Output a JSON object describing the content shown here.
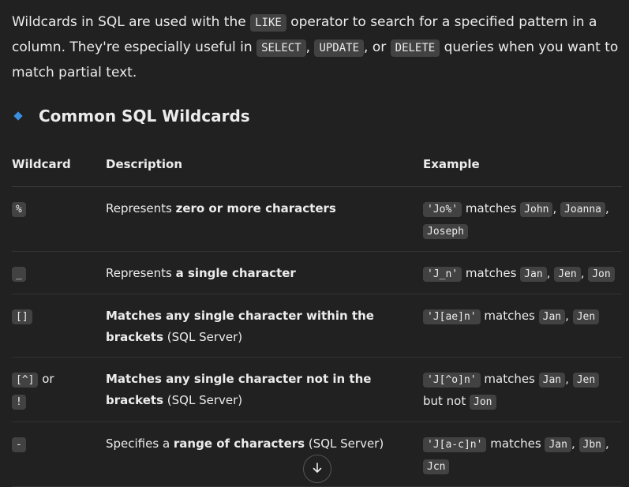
{
  "intro": {
    "t1": "Wildcards in SQL are used with the ",
    "c1": "LIKE",
    "t2": " operator to search for a specified pattern in a column. They're especially useful in ",
    "c2": "SELECT",
    "t3": ", ",
    "c3": "UPDATE",
    "t4": ", or ",
    "c4": "DELETE",
    "t5": " queries when you want to match partial text."
  },
  "heading": "Common SQL Wildcards",
  "table": {
    "headers": [
      "Wildcard",
      "Description",
      "Example"
    ],
    "rows": [
      {
        "wildcard": "%",
        "desc_pre": "Represents ",
        "desc_bold": "zero or more characters",
        "desc_post": "",
        "pattern": "'Jo%'",
        "matches_word": " matches ",
        "m1": "John",
        "m2": "Joanna",
        "m3": "Joseph"
      },
      {
        "wildcard": "_",
        "desc_pre": "Represents ",
        "desc_bold": "a single character",
        "pattern": "'J_n'",
        "matches_word": " matches ",
        "m1": "Jan",
        "m2": "Jen",
        "m3": "Jon"
      },
      {
        "wildcard": "[]",
        "desc_bold": "Matches any single character within the brackets",
        "desc_post": " (SQL Server)",
        "pattern": "'J[ae]n'",
        "matches_word": " matches ",
        "m1": "Jan",
        "m2": "Jen"
      },
      {
        "wildcard": "[^]",
        "or_word": " or ",
        "wildcard2": "!",
        "desc_bold": "Matches any single character not in the brackets",
        "desc_post": " (SQL Server)",
        "pattern": "'J[^o]n'",
        "matches_word": " matches ",
        "m1": "Jan",
        "m2": "Jen",
        "but_not": " but not ",
        "m3": "Jon"
      },
      {
        "wildcard": "-",
        "desc_pre": "Specifies a ",
        "desc_bold": "range of characters",
        "desc_post": " (SQL Server)",
        "pattern": "'J[a-c]n'",
        "matches_word": " matches ",
        "m1": "Jan",
        "m2": "Jbn",
        "m3": "Jcn"
      }
    ]
  },
  "scroll_icon": "arrow-down-icon",
  "colors": {
    "background": "#212121",
    "code_bg": "#424242",
    "accent": "#3b8fe0"
  }
}
